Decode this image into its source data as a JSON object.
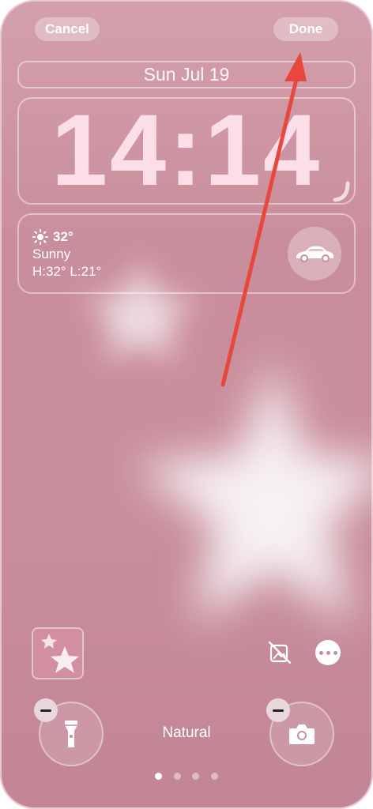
{
  "header": {
    "cancel_label": "Cancel",
    "done_label": "Done"
  },
  "lockscreen": {
    "date": "Sun Jul 19",
    "time": "14:14"
  },
  "weather_widget": {
    "temperature": "32°",
    "condition": "Sunny",
    "high_low": "H:32° L:21°",
    "icon": "sun-icon"
  },
  "car_widget": {
    "icon": "car-icon"
  },
  "bottom": {
    "filter_label": "Natural",
    "flashlight_icon": "flashlight-icon",
    "camera_icon": "camera-icon",
    "page_count": 4,
    "active_page": 1
  },
  "colors": {
    "wallpaper_pink": "#c98e9b",
    "annotation_arrow": "#e8473d"
  }
}
